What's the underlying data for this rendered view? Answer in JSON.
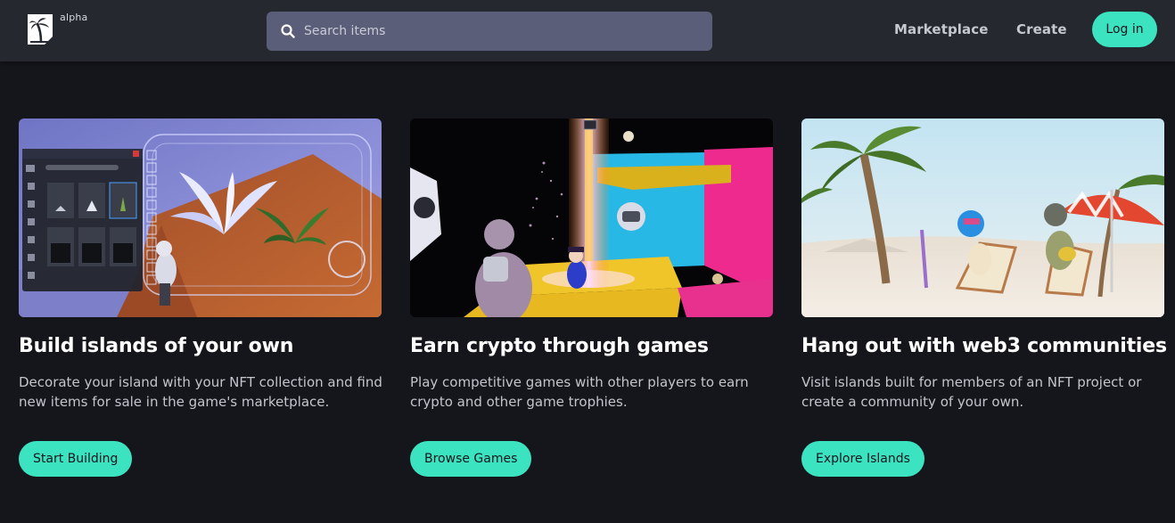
{
  "header": {
    "logo_text": "alpha",
    "search_placeholder": "Search items",
    "nav": {
      "marketplace": "Marketplace",
      "create": "Create"
    },
    "login_label": "Log in"
  },
  "colors": {
    "background": "#15161b",
    "header": "#262830",
    "search_field": "#5a5e78",
    "accent": "#3ce3c0"
  },
  "cards": [
    {
      "title": "Build islands of your own",
      "description": "Decorate your island with your NFT collection and find new items for sale in the game's marketplace.",
      "button": "Start Building",
      "image": "island-builder-screenshot"
    },
    {
      "title": "Earn crypto through games",
      "description": "Play competitive games with other players to earn crypto and other game trophies.",
      "button": "Browse Games",
      "image": "game-arena-screenshot"
    },
    {
      "title": "Hang out with web3 communities",
      "description": "Visit islands built for members of an NFT project or create a community of your own.",
      "button": "Explore Islands",
      "image": "beach-island-screenshot"
    }
  ]
}
